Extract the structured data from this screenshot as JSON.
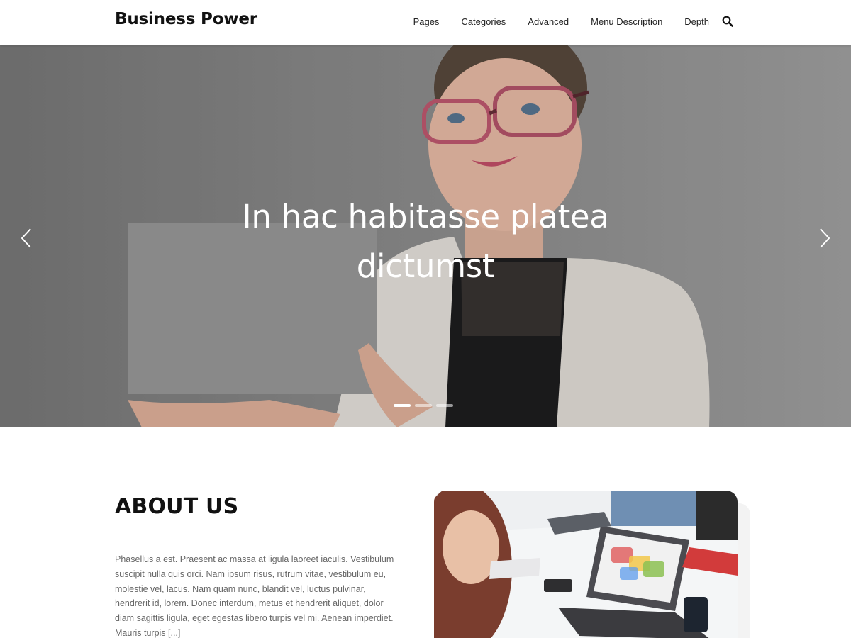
{
  "header": {
    "brand": "Business Power",
    "nav": [
      "Pages",
      "Categories",
      "Advanced",
      "Menu Description",
      "Depth"
    ],
    "search_icon": "search-icon"
  },
  "hero": {
    "title_line1": "In hac habitasse platea",
    "title_line2": "dictumst",
    "slides_total": 3,
    "active_slide": 1,
    "prev_icon": "chevron-left-icon",
    "next_icon": "chevron-right-icon"
  },
  "about": {
    "title": "ABOUT US",
    "text": "Phasellus a est. Praesent ac massa at ligula laoreet iaculis. Vestibulum suscipit nulla quis orci. Nam ipsum risus, rutrum vitae, vestibulum eu, molestie vel, lacus. Nam quam nunc, blandit vel, luctus pulvinar, hendrerit id, lorem. Donec interdum, metus et hendrerit aliquet, dolor diam sagittis ligula, eget egestas libero turpis vel mi. Aenean imperdiet. Mauris turpis [...]"
  },
  "colors": {
    "accent": "#111111",
    "body_text": "#666666"
  }
}
